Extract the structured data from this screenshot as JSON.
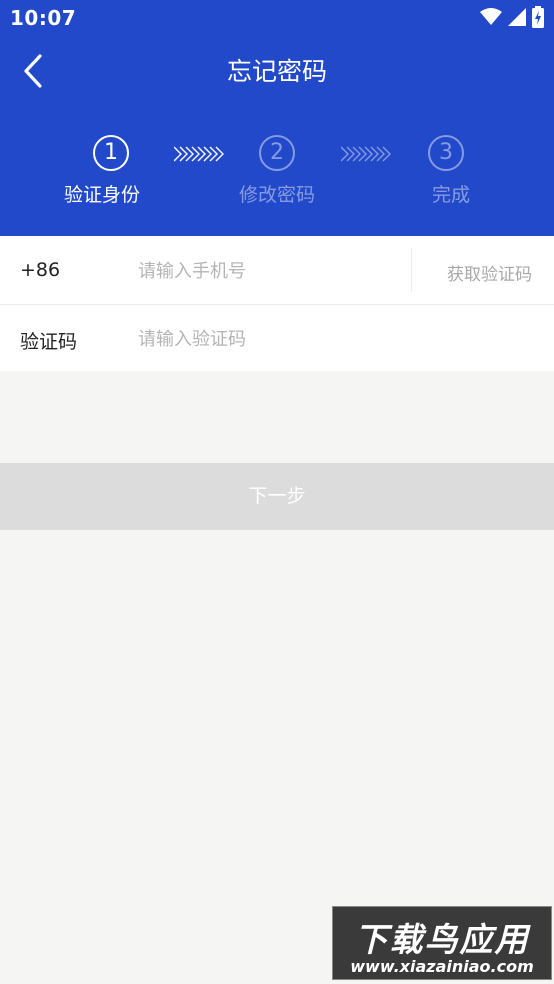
{
  "status_bar": {
    "time": "10:07"
  },
  "header": {
    "title": "忘记密码"
  },
  "steps": [
    {
      "number": "1",
      "label": "验证身份",
      "active": true
    },
    {
      "number": "2",
      "label": "修改密码",
      "active": false
    },
    {
      "number": "3",
      "label": "完成",
      "active": false
    }
  ],
  "form": {
    "phone": {
      "prefix": "+86",
      "placeholder": "请输入手机号",
      "value": ""
    },
    "get_code_label": "获取验证码",
    "code": {
      "label": "验证码",
      "placeholder": "请输入验证码",
      "value": ""
    }
  },
  "next_button": {
    "label": "下一步"
  },
  "watermark": {
    "title": "下载鸟应用",
    "url": "www.xiazainiao.com"
  },
  "colors": {
    "primary": "#2249c9",
    "background": "#f5f5f3",
    "disabled_button": "#dcdcdc"
  }
}
